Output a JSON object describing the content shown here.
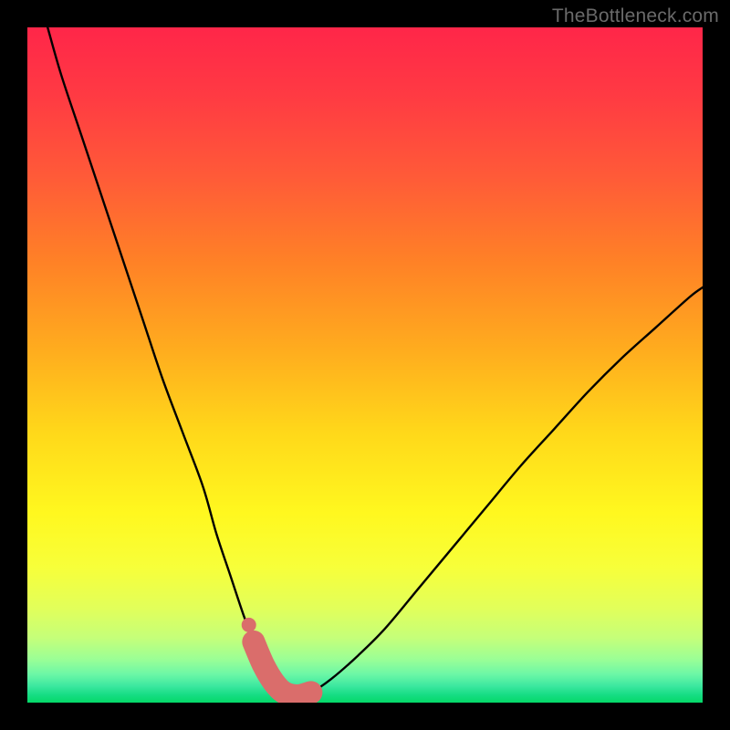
{
  "watermark": "TheBottleneck.com",
  "colors": {
    "black": "#000000",
    "curve_stroke": "#000000",
    "marker": "#da6d6b",
    "watermark": "#6a6a6a"
  },
  "gradient_stops": [
    {
      "offset": 0.0,
      "color": "#ff2649"
    },
    {
      "offset": 0.1,
      "color": "#ff3a43"
    },
    {
      "offset": 0.22,
      "color": "#ff5a38"
    },
    {
      "offset": 0.35,
      "color": "#ff8226"
    },
    {
      "offset": 0.48,
      "color": "#ffad1e"
    },
    {
      "offset": 0.6,
      "color": "#ffd81a"
    },
    {
      "offset": 0.72,
      "color": "#fff81f"
    },
    {
      "offset": 0.8,
      "color": "#f7ff3a"
    },
    {
      "offset": 0.86,
      "color": "#e2ff5a"
    },
    {
      "offset": 0.905,
      "color": "#c4ff7a"
    },
    {
      "offset": 0.935,
      "color": "#9cff95"
    },
    {
      "offset": 0.958,
      "color": "#6cf7a6"
    },
    {
      "offset": 0.975,
      "color": "#3de8a0"
    },
    {
      "offset": 0.988,
      "color": "#17dd85"
    },
    {
      "offset": 1.0,
      "color": "#04d968"
    }
  ],
  "chart_data": {
    "type": "line",
    "title": "",
    "xlabel": "",
    "ylabel": "",
    "xlim": [
      0,
      100
    ],
    "ylim": [
      0,
      100
    ],
    "series": [
      {
        "name": "bottleneck-curve",
        "x": [
          3,
          5,
          8,
          11,
          14,
          17,
          20,
          23,
          26,
          28,
          30,
          32,
          33.5,
          35,
          36.5,
          38,
          40,
          42,
          45,
          49,
          53,
          58,
          63,
          68,
          73,
          78,
          83,
          88,
          93,
          98,
          100
        ],
        "y": [
          100,
          93,
          84,
          75,
          66,
          57,
          48,
          40,
          32,
          25,
          19,
          13,
          9,
          5.5,
          3,
          1.5,
          1,
          1.5,
          3.5,
          7,
          11,
          17,
          23,
          29,
          35,
          40.5,
          46,
          51,
          55.5,
          60,
          61.5
        ]
      }
    ],
    "markers": [
      {
        "name": "left-dot",
        "x": 32.8,
        "y": 11.5,
        "r": 1.2
      },
      {
        "name": "bottom-band",
        "x_from": 33.5,
        "x_to": 43,
        "y": 1.2,
        "thickness": 3.4
      }
    ]
  }
}
